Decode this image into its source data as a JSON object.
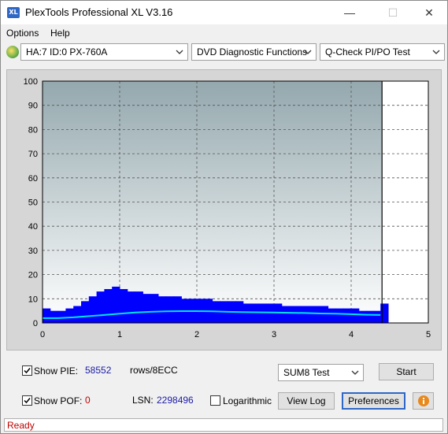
{
  "window": {
    "title": "PlexTools Professional XL V3.16",
    "icon_text": "XL"
  },
  "menu": {
    "items": [
      "Options",
      "Help"
    ]
  },
  "toolbar": {
    "drive": "HA:7 ID:0  PX-760A",
    "function": "DVD Diagnostic Functions",
    "test": "Q-Check PI/PO Test"
  },
  "chart_data": {
    "type": "bar",
    "x_ticks": [
      "0",
      "1",
      "2",
      "3",
      "4",
      "5"
    ],
    "y_ticks": [
      "0",
      "10",
      "20",
      "30",
      "40",
      "50",
      "60",
      "70",
      "80",
      "90",
      "100"
    ],
    "xlim": [
      0,
      5
    ],
    "ylim": [
      0,
      100
    ],
    "grid": true,
    "end_marker_x": 4.4,
    "series": [
      {
        "type": "bar",
        "color": "#0000ff",
        "x": [
          0.0,
          0.1,
          0.2,
          0.3,
          0.4,
          0.5,
          0.6,
          0.7,
          0.8,
          0.9,
          1.0,
          1.1,
          1.2,
          1.3,
          1.4,
          1.5,
          1.6,
          1.7,
          1.8,
          1.9,
          2.0,
          2.1,
          2.2,
          2.3,
          2.4,
          2.5,
          2.6,
          2.7,
          2.8,
          2.9,
          3.0,
          3.1,
          3.2,
          3.3,
          3.4,
          3.5,
          3.6,
          3.7,
          3.8,
          3.9,
          4.0,
          4.1,
          4.2,
          4.3,
          4.38
        ],
        "values": [
          6,
          5,
          5,
          6,
          7,
          9,
          11,
          13,
          14,
          15,
          14,
          13,
          13,
          12,
          12,
          11,
          11,
          11,
          10,
          10,
          10,
          10,
          9,
          9,
          9,
          9,
          8,
          8,
          8,
          8,
          8,
          7,
          7,
          7,
          7,
          7,
          7,
          6,
          6,
          6,
          6,
          5,
          5,
          5,
          8
        ]
      },
      {
        "type": "line",
        "color": "#00e5e5",
        "x": [
          0.0,
          0.2,
          0.4,
          0.6,
          0.8,
          1.0,
          1.2,
          1.4,
          1.6,
          1.8,
          2.0,
          2.2,
          2.4,
          2.6,
          2.8,
          3.0,
          3.2,
          3.4,
          3.6,
          3.8,
          4.0,
          4.2,
          4.38
        ],
        "values": [
          2,
          2,
          2.3,
          2.8,
          3.3,
          3.8,
          4.3,
          4.6,
          4.8,
          4.9,
          4.9,
          4.8,
          4.6,
          4.5,
          4.4,
          4.3,
          4.2,
          4.1,
          3.9,
          3.8,
          3.6,
          3.4,
          3.3
        ]
      }
    ]
  },
  "controls": {
    "show_pie_label": "Show PIE:",
    "pie_value": "58552",
    "rows_label": "rows/8ECC",
    "test_select": "SUM8 Test",
    "start_label": "Start",
    "show_pof_label": "Show POF:",
    "pof_value": "0",
    "lsn_label": "LSN:",
    "lsn_value": "2298496",
    "logarithmic_label": "Logarithmic",
    "view_log_label": "View Log",
    "preferences_label": "Preferences"
  },
  "status": {
    "text": "Ready"
  }
}
